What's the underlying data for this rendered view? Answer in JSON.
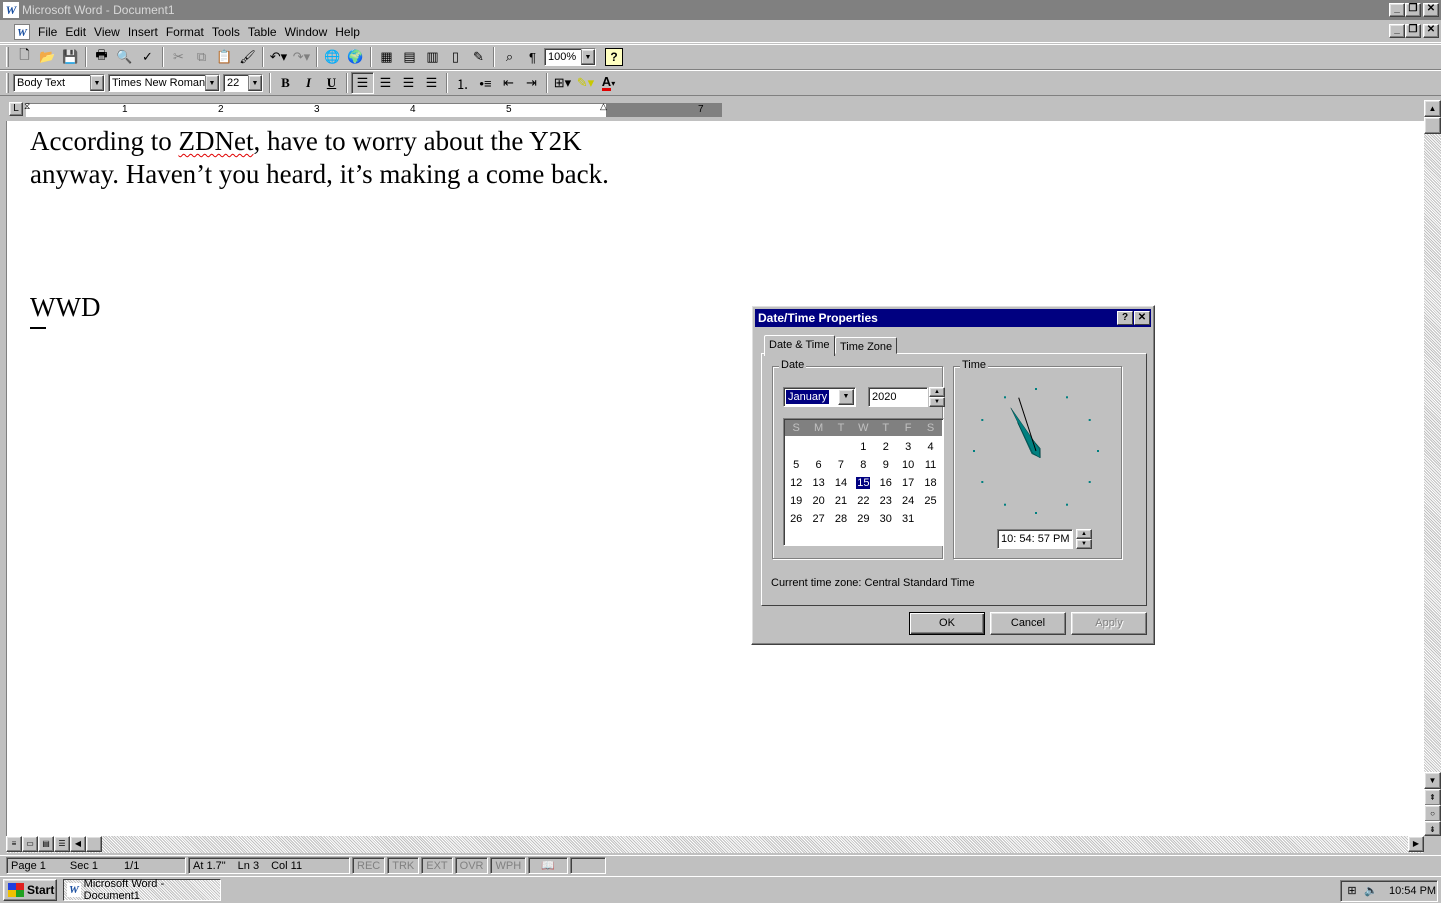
{
  "window": {
    "title": "Microsoft Word - Document1",
    "app_icon": "W"
  },
  "menu": {
    "doc_icon": "W",
    "items": [
      {
        "label": "File"
      },
      {
        "label": "Edit"
      },
      {
        "label": "View"
      },
      {
        "label": "Insert"
      },
      {
        "label": "Format"
      },
      {
        "label": "Tools"
      },
      {
        "label": "Table"
      },
      {
        "label": "Window"
      },
      {
        "label": "Help"
      }
    ]
  },
  "toolbar": {
    "zoom": "100%",
    "help_glyph": "?",
    "style": "Body Text",
    "font": "Times New Roman",
    "size": "22",
    "bold": "B",
    "italic": "I",
    "underline": "U",
    "font_color_glyph": "A"
  },
  "ruler": {
    "tab_stop_glyph": "L",
    "numbers": [
      "1",
      "2",
      "3",
      "4",
      "5",
      "7"
    ]
  },
  "document": {
    "para1_before": "According to ",
    "para1_misspelled": "ZDNet",
    "para1_after": ", have to worry about the Y2K anyway.  Haven’t you heard, it’s making a come back.",
    "para2": "WWD"
  },
  "statusbar": {
    "page": "Page  1",
    "section": "Sec  1",
    "page_of": "1/1",
    "at": "At  1.7\"",
    "line": "Ln  3",
    "col": "Col  11",
    "modes": [
      "REC",
      "TRK",
      "EXT",
      "OVR",
      "WPH"
    ]
  },
  "taskbar": {
    "start": "Start",
    "task_word": "Microsoft Word - Document1",
    "clock": "10:54 PM"
  },
  "dialog": {
    "title": "Date/Time Properties",
    "help_glyph": "?",
    "close_glyph": "✕",
    "tabs": [
      "Date & Time",
      "Time Zone"
    ],
    "date_label": "Date",
    "time_label": "Time",
    "month": "January",
    "year": "2020",
    "weekdays": [
      "S",
      "M",
      "T",
      "W",
      "T",
      "F",
      "S"
    ],
    "weeks": [
      [
        "",
        "",
        "",
        "1",
        "2",
        "3",
        "4"
      ],
      [
        "5",
        "6",
        "7",
        "8",
        "9",
        "10",
        "11"
      ],
      [
        "12",
        "13",
        "14",
        "15",
        "16",
        "17",
        "18"
      ],
      [
        "19",
        "20",
        "21",
        "22",
        "23",
        "24",
        "25"
      ],
      [
        "26",
        "27",
        "28",
        "29",
        "30",
        "31",
        ""
      ]
    ],
    "selected_day": "15",
    "time": "10: 54: 57 PM",
    "clock": {
      "hour": 10,
      "minute": 54,
      "second": 57
    },
    "timezone_text": "Current time zone:  Central Standard Time",
    "buttons": {
      "ok": "OK",
      "cancel": "Cancel",
      "apply": "Apply"
    }
  }
}
